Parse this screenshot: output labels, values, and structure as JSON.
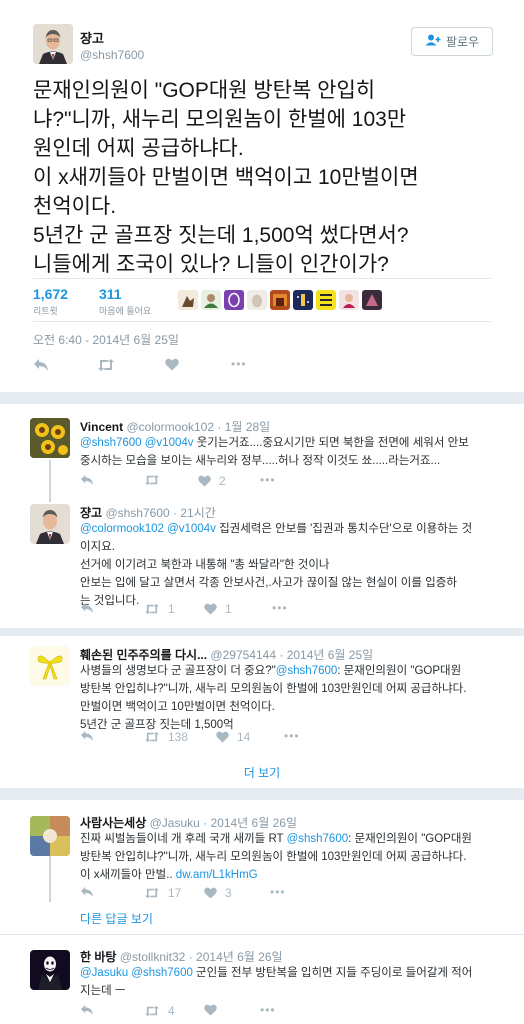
{
  "main_tweet": {
    "name": "쟝고",
    "handle": "@shsh7600",
    "follow_label": "팔로우",
    "lines": [
      "문재인의원이 \"GOP대원 방탄복 안입히",
      "냐?\"니까, 새누리 모의원놈이 한벌에 103만",
      "원인데 어찌 공급하냐다.",
      "이 x새끼들아 만벌이면 백억이고 10만벌이면",
      "천억이다.",
      "5년간 군 골프장 짓는데 1,500억 썼다면서?",
      "니들에게 조국이 있나? 니들이 인간이가?"
    ],
    "retweets": "1,672",
    "retweets_label": "리트윗",
    "likes": "311",
    "likes_label": "마음에 들어요",
    "timestamp": "오전 6:40 - 2014년 6월 25일",
    "more": "•••"
  },
  "replies": [
    {
      "name": "Vincent",
      "handle": "@colormook102",
      "time": "1월 28일",
      "mentions": "@shsh7600 @v1004v",
      "line1_rest": " 웃기는거죠....중요시기만 되면 북한을 전면에 세워서 안보",
      "line2": "중시하는 모습을 보이는 새누리와 정부.....허나 정작 이것도 쑈.....라는거죠...",
      "retweets": "",
      "likes": "2"
    },
    {
      "name": "쟝고",
      "handle": "@shsh7600",
      "time": "21시간",
      "mentions": "@colormook102 @v1004v",
      "line1_rest": " 집권세력은 안보를 '집권과 통치수단'으로 이용하는 것",
      "line2": "이지요.",
      "line3": "선거에 이기려고 북한과 내통해 \"총 쏴달라\"한 것이나",
      "line4": "안보는 입에 달고 살면서 각종 안보사건,.사고가 끊이질 않는 현실이 이를 입증하",
      "line5": "는 것입니다.",
      "retweets": "1",
      "likes": "1"
    },
    {
      "name": "훼손된 민주주의를 다시...",
      "handle": "@29754144",
      "time": "2014년 6월 25일",
      "line1_pre": "사병들의 생명보다 군 골프장이 더 중요?\"",
      "line1_mention": "@shsh7600",
      "line1_post": ": 문재인의원이 \"GOP대원",
      "line2": "방탄복 안입히냐?\"니까, 새누리 모의원놈이 한벌에 103만원인데 어찌 공급하냐다.",
      "line3": "만벌이면 백억이고 10만벌이면 천억이다.",
      "line4": "5년간 군 골프장 짓는데 1,500억",
      "retweets": "138",
      "likes": "14",
      "show_more": "더 보기"
    },
    {
      "name": "사람사는세상",
      "handle": "@Jasuku",
      "time": "2014년 6월 26일",
      "line1_pre": "진짜 씨벌놈들이네 개 후레 국개 새끼들 RT ",
      "line1_mention": "@shsh7600",
      "line1_post": ": 문재인의원이 \"GOP대원",
      "line2": "방탄복 안입히냐?\"니까, 새누리 모의원놈이 한벌에 103만원인데 어찌 공급하냐다.",
      "line3_pre": "이 x새끼들아 만벌.. ",
      "line3_link": "dw.am/L1kHmG",
      "retweets": "17",
      "likes": "3",
      "other_replies": "다른 답글 보기"
    },
    {
      "name": "한 바탕",
      "handle": "@stollknit32",
      "time": "2014년 6월 26일",
      "mentions": "@Jasuku @shsh7600",
      "line1_rest": " 군인들 전부 방탄복을 입히면 지들 주딩이로 들어갈게 적어",
      "line2": "지는데 ㅡ",
      "retweets": "4",
      "likes": ""
    }
  ],
  "colors": {
    "link": "#1b95e0",
    "muted": "#8899a6",
    "icon": "#aab8c2",
    "background": "#e6ecf0"
  }
}
